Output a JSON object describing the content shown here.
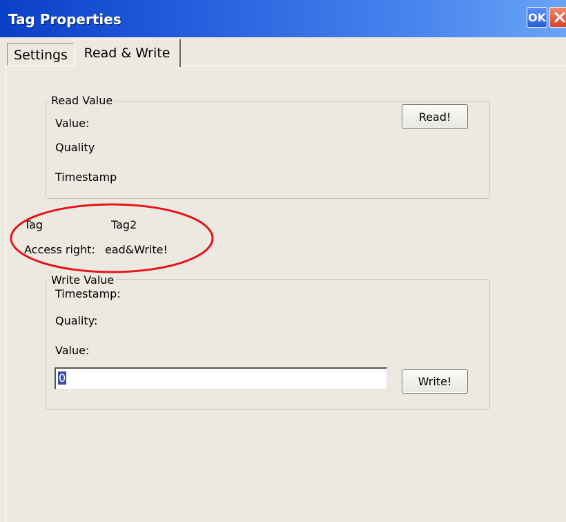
{
  "window": {
    "title": "Tag Properties",
    "ok_label": "OK",
    "close_icon": "close-icon"
  },
  "tabs": [
    {
      "label": "Settings",
      "active": false
    },
    {
      "label": "Read & Write",
      "active": true
    }
  ],
  "read_group": {
    "legend": "Read Value",
    "value_label": "Value:",
    "quality_label": "Quality",
    "timestamp_label": "Timestamp",
    "button_label": "Read!"
  },
  "tag_info": {
    "tag_label": "Tag",
    "tag_value": "Tag2",
    "access_label": "Access right:",
    "access_value": "ead&Write!"
  },
  "write_group": {
    "legend": "Write Value",
    "timestamp_label": "Timestamp:",
    "quality_label": "Quality:",
    "value_label": "Value:",
    "input_value": "0",
    "button_label": "Write!"
  },
  "colors": {
    "titlebar": "#2a64e0",
    "panel_bg": "#ece9e1",
    "annotation_ellipse": "#e8121a"
  }
}
